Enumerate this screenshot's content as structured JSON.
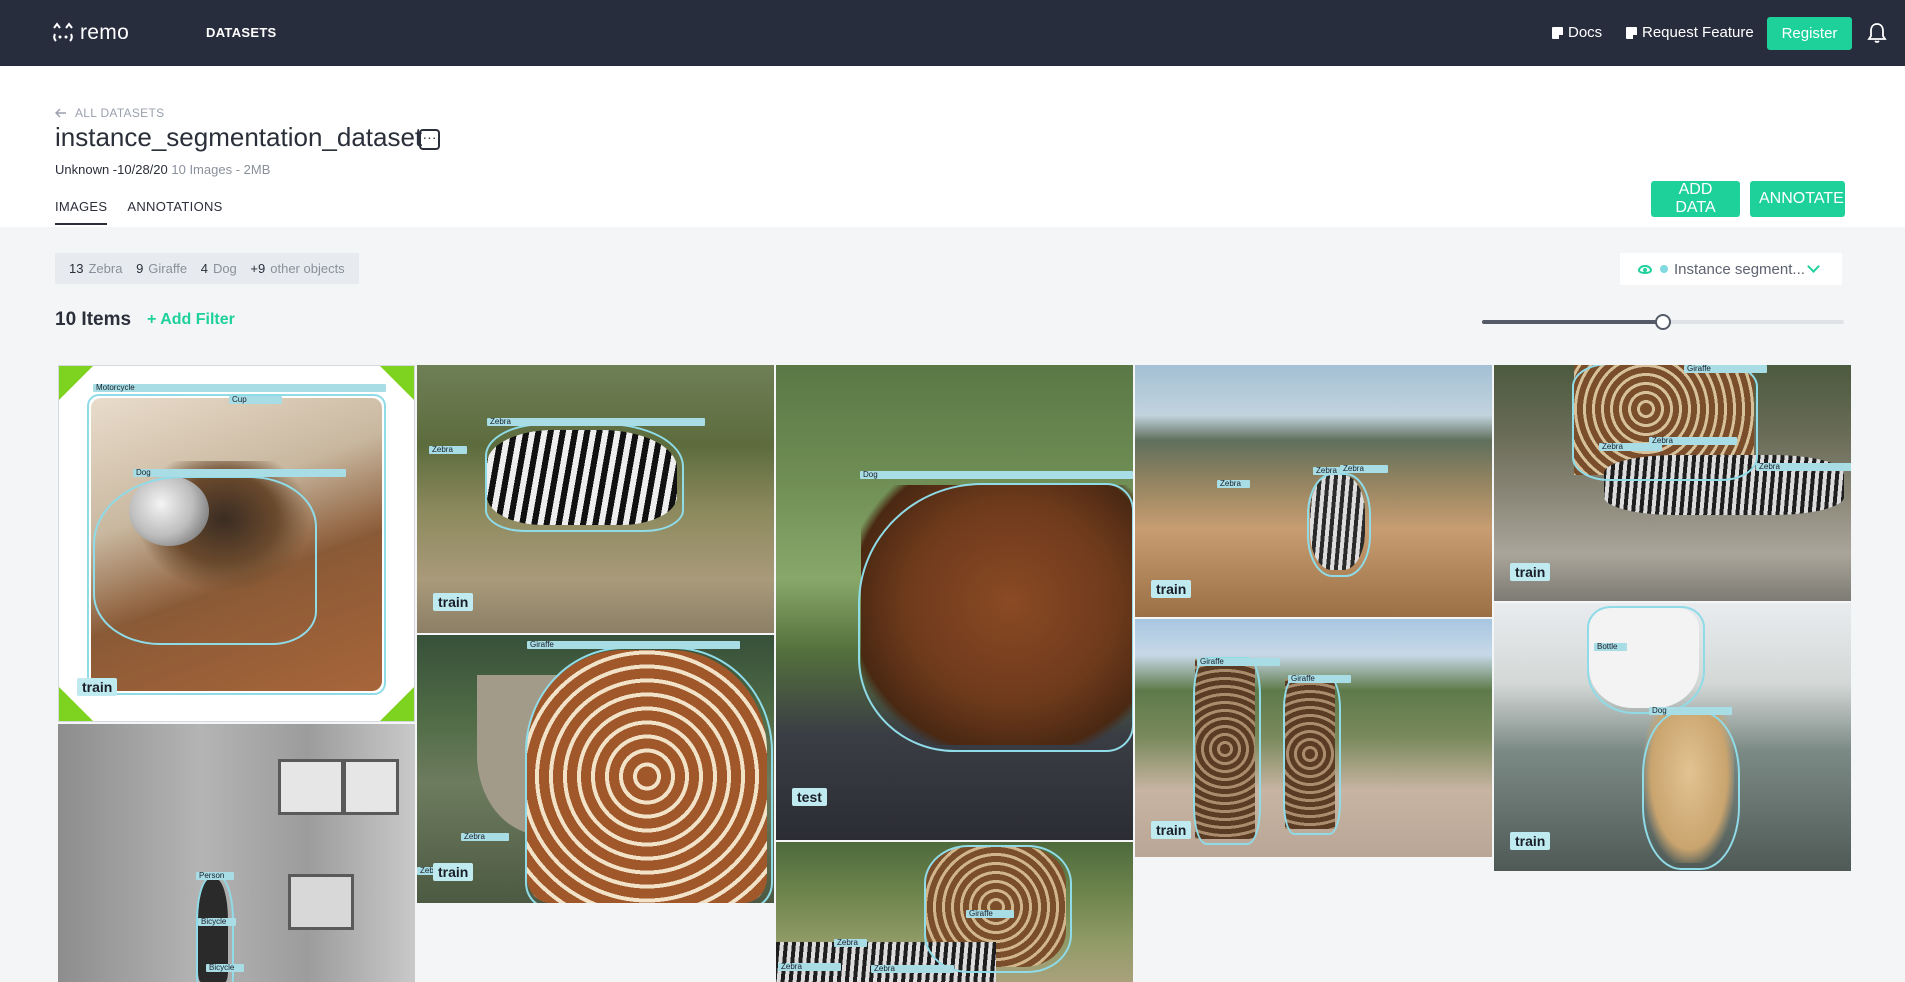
{
  "app": {
    "logo_text": "remo"
  },
  "nav": {
    "datasets": "DATASETS",
    "docs": "Docs",
    "request_feature": "Request Feature",
    "register": "Register"
  },
  "header": {
    "back": "ALL DATASETS",
    "title": "instance_segmentation_dataset",
    "more": "···",
    "meta_owner": "Unknown -10/28/20",
    "meta_info": "10 Images - 2MB",
    "tabs": [
      {
        "label": "IMAGES",
        "active": true
      },
      {
        "label": "ANNOTATIONS",
        "active": false
      }
    ],
    "add_data": "ADD DATA",
    "annotate": "ANNOTATE"
  },
  "stats": {
    "items": [
      {
        "count": "13",
        "name": "Zebra"
      },
      {
        "count": "9",
        "name": "Giraffe"
      },
      {
        "count": "4",
        "name": "Dog"
      },
      {
        "count": "+9",
        "name": "other objects"
      }
    ]
  },
  "view": {
    "selected": "Instance segment..."
  },
  "toolbar": {
    "items_count": "10 Items",
    "add_filter": "+ Add Filter",
    "zoom_level": 0.5
  },
  "colors": {
    "accent": "#1ed09a",
    "nav_bg": "#282d3e",
    "label_bg": "#a8dde6",
    "selected": "#7ed321"
  },
  "images": [
    {
      "split": "train",
      "labels": [
        "Motorcycle",
        "Cup",
        "Dog"
      ]
    },
    {
      "split": "train",
      "labels": [
        "Zebra",
        "Zebra"
      ]
    },
    {
      "split": "test",
      "labels": [
        "Dog"
      ]
    },
    {
      "split": "train",
      "labels": [
        "Zebra",
        "Zebra",
        "Zebra"
      ]
    },
    {
      "split": "train",
      "labels": [
        "Giraffe",
        "Zebra",
        "Zebra",
        "Zebra"
      ]
    },
    {
      "split": "train",
      "labels": [
        "Giraffe",
        "Zebra",
        "Zebra"
      ]
    },
    {
      "split": "train",
      "labels": [
        "Giraffe",
        "Giraffe"
      ]
    },
    {
      "split": "train",
      "labels": [
        "Bottle",
        "Dog"
      ]
    },
    {
      "split": "",
      "labels": [
        "Person",
        "Bicycle",
        "Bicycle"
      ]
    },
    {
      "split": "",
      "labels": [
        "Giraffe",
        "Zebra",
        "Zebra",
        "Zebra"
      ]
    }
  ]
}
